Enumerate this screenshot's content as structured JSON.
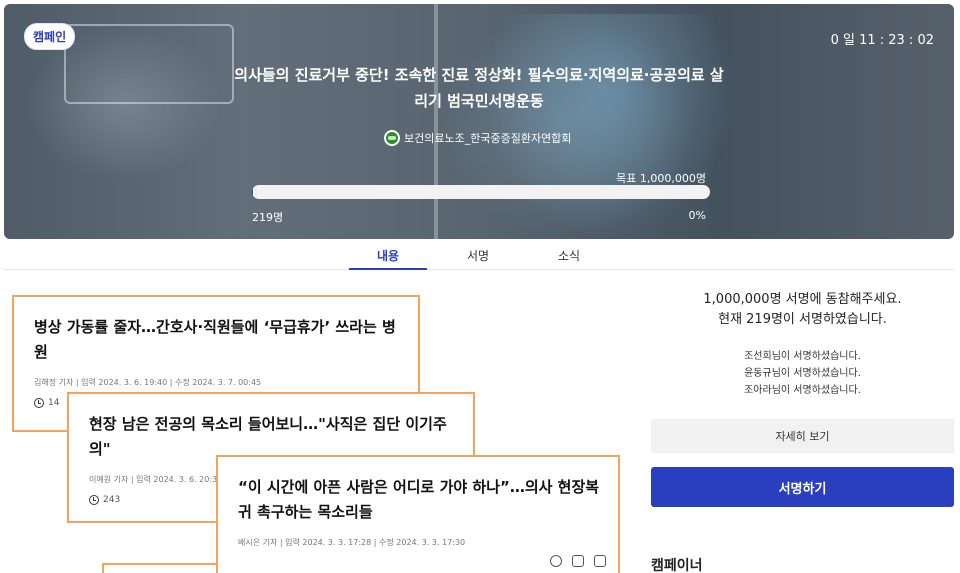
{
  "hero": {
    "badge": "캠페인",
    "timer": "0 일 11 : 23 : 02",
    "title": "의사들의 진료거부 중단! 조속한 진료 정상화! 필수의료·지역의료·공공의료 살리기 범국민서명운동",
    "organization": "보건의료노조_한국중증질환자연합회",
    "goal": "목표 1,000,000명",
    "count": "219명",
    "percent": "0%",
    "progress_fraction": 0.0002
  },
  "tabs": [
    "내용",
    "서명",
    "소식"
  ],
  "active_tab": "내용",
  "articles": [
    {
      "title": "병상 가동률 줄자…간호사·직원들에 ‘무급휴가’ 쓰라는 병원",
      "meta": "김해정 기자  |  입력 2024. 3. 6. 19:40  |  수정 2024. 3. 7. 00:45",
      "comments": "14"
    },
    {
      "title": "현장 남은 전공의 목소리 들어보니…\"사직은 집단 이기주의\"",
      "meta": "이예원 기자  |  입력 2024. 3. 6. 20:30",
      "comments": "243"
    },
    {
      "title": "“이 시간에 아픈 사람은 어디로 가야 하나”…의사 현장복귀 촉구하는 목소리들",
      "meta": "배시은 기자  |  입력 2024. 3. 3. 17:28  |  수정 2024. 3. 3. 17:30"
    }
  ],
  "panel": {
    "headline_1": "1,000,000명 서명에 동참해주세요.",
    "headline_2": "현재 219명이 서명하였습니다.",
    "signers": [
      "조선희님이 서명하셨습니다.",
      "윤동규님이 서명하셨습니다.",
      "조아라님이 서명하셨습니다."
    ],
    "detail_button": "자세히 보기",
    "sign_button": "서명하기",
    "section_label": "캠페이너"
  },
  "colors": {
    "accent": "#2a3fbf",
    "card_border": "#f5a25d"
  }
}
